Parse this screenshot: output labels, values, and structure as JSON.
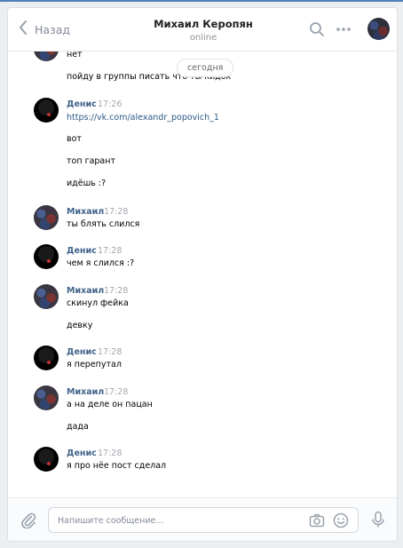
{
  "header": {
    "back_label": "Назад",
    "title": "Михаил Керопян",
    "status": "online"
  },
  "date_divider": "сегодня",
  "messages": [
    {
      "author": "",
      "time": "",
      "avatar": "m",
      "lines": [
        "нет",
        "пойду в группы писать что ты кидок"
      ]
    },
    {
      "author": "Денис",
      "time": "17:26",
      "avatar": "d",
      "lines": [
        "https://vk.com/alexandr_popovich_1",
        "вот",
        "топ гарант",
        "идёшь :?"
      ]
    },
    {
      "author": "Михаил",
      "time": "17:28",
      "avatar": "m",
      "lines": [
        "ты блять слился"
      ]
    },
    {
      "author": "Денис",
      "time": "17:28",
      "avatar": "d",
      "lines": [
        "чем я слился :?"
      ]
    },
    {
      "author": "Михаил",
      "time": "17:28",
      "avatar": "m",
      "lines": [
        "скинул фейка",
        "девку"
      ]
    },
    {
      "author": "Денис",
      "time": "17:28",
      "avatar": "d",
      "lines": [
        "я перепутал"
      ]
    },
    {
      "author": "Михаил",
      "time": "17:28",
      "avatar": "m",
      "lines": [
        "а на деле он пацан",
        "дада"
      ]
    },
    {
      "author": "Денис",
      "time": "17:28",
      "avatar": "d",
      "lines": [
        "я про нёе пост сделал"
      ]
    }
  ],
  "composer": {
    "placeholder": "Напишите сообщение..."
  },
  "colors": {
    "accent": "#5181b8",
    "author": "#42648b",
    "link": "#2a5885",
    "muted": "#828a99"
  },
  "icons": [
    "chevron-left-icon",
    "search-icon",
    "more-icon",
    "paperclip-icon",
    "camera-icon",
    "smile-icon",
    "microphone-icon"
  ]
}
